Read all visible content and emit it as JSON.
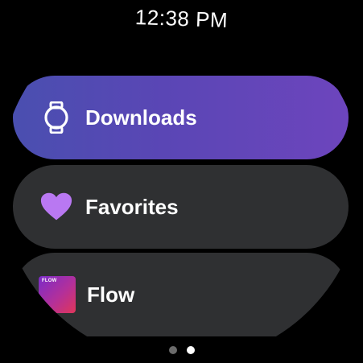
{
  "status": {
    "time": "12:38 PM"
  },
  "menu": {
    "items": [
      {
        "label": "Downloads",
        "icon": "watch-icon",
        "style": "gradient"
      },
      {
        "label": "Favorites",
        "icon": "heart-icon",
        "style": "dark"
      },
      {
        "label": "Flow",
        "icon": "flow-app-icon",
        "icon_text": "FLOW",
        "style": "dark"
      }
    ]
  },
  "pagination": {
    "total": 2,
    "current": 2
  },
  "colors": {
    "background": "#000000",
    "chip_dark": "#2f3032",
    "gradient_start": "#4a4fb0",
    "gradient_end": "#6d45bd",
    "heart": "#b978f2",
    "text": "#ffffff",
    "dot_inactive": "#6b6b6b",
    "dot_active": "#ffffff"
  }
}
